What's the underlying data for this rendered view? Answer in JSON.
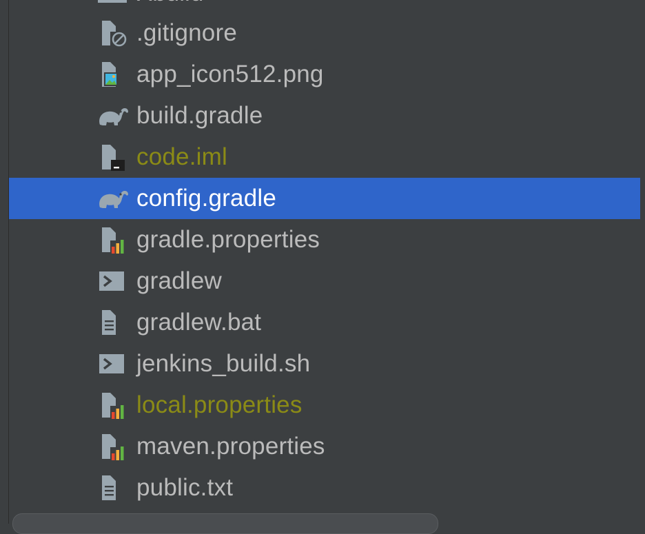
{
  "tree": {
    "partial_top_item": {
      "label": "Xbuild",
      "icon": "folder-icon"
    },
    "items": [
      {
        "label": ".gitignore",
        "icon": "ignore-file-icon",
        "status": "normal"
      },
      {
        "label": "app_icon512.png",
        "icon": "image-file-icon",
        "status": "normal"
      },
      {
        "label": "build.gradle",
        "icon": "gradle-elephant-icon",
        "status": "normal"
      },
      {
        "label": "code.iml",
        "icon": "module-file-icon",
        "status": "ignored"
      },
      {
        "label": "config.gradle",
        "icon": "gradle-elephant-icon",
        "status": "selected"
      },
      {
        "label": "gradle.properties",
        "icon": "properties-file-icon",
        "status": "normal"
      },
      {
        "label": "gradlew",
        "icon": "shell-script-icon",
        "status": "normal"
      },
      {
        "label": "gradlew.bat",
        "icon": "text-file-icon",
        "status": "normal"
      },
      {
        "label": "jenkins_build.sh",
        "icon": "shell-script-icon",
        "status": "normal"
      },
      {
        "label": "local.properties",
        "icon": "properties-file-icon",
        "status": "ignored"
      },
      {
        "label": "maven.properties",
        "icon": "properties-file-icon",
        "status": "normal"
      },
      {
        "label": "public.txt",
        "icon": "text-file-icon",
        "status": "normal"
      }
    ]
  },
  "colors": {
    "background": "#3c3f41",
    "selection": "#2f65ca",
    "text": "#bbbbbb",
    "ignored_text": "#8b8b16",
    "selected_text": "#ffffff",
    "icon_gray": "#9aa7b0"
  }
}
